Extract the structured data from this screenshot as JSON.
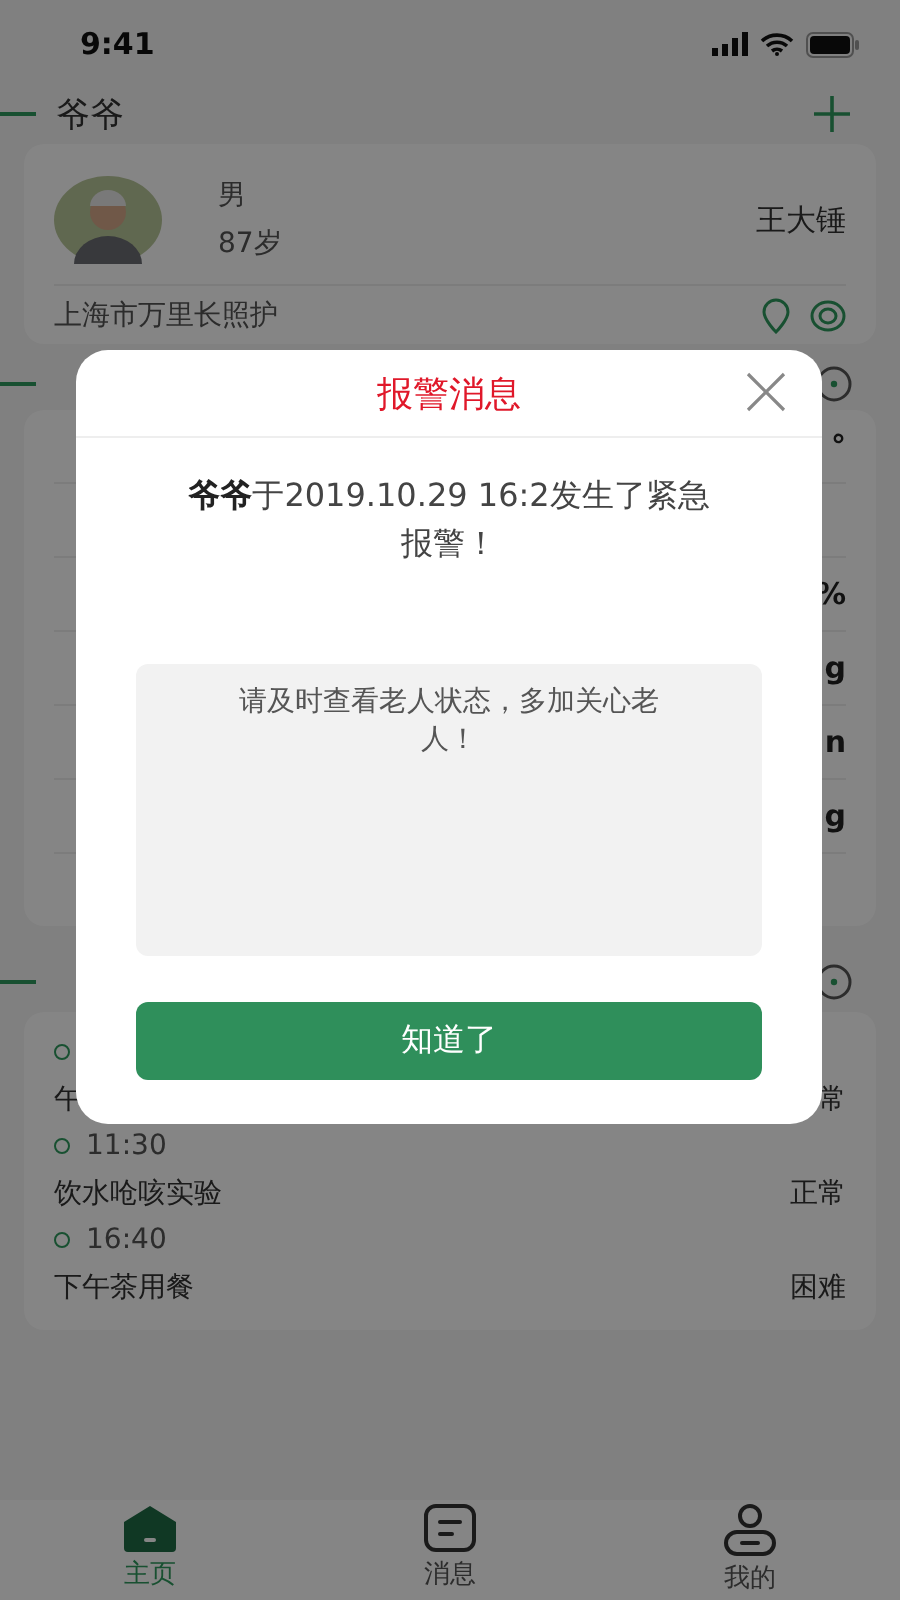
{
  "status_bar": {
    "time": "9:41"
  },
  "person": {
    "title": "爷爷",
    "gender": "男",
    "age": "87岁",
    "caregiver": "王大锤",
    "organization": "上海市万里长照护"
  },
  "basic_info": {
    "rows": [
      {
        "kind": "value",
        "value": "°"
      },
      {
        "kind": "covered"
      },
      {
        "kind": "value",
        "value": "%"
      },
      {
        "kind": "value",
        "value": "g"
      },
      {
        "kind": "value",
        "value": "n"
      },
      {
        "kind": "value",
        "value": "g"
      },
      {
        "kind": "covered"
      }
    ]
  },
  "schedule": {
    "items": [
      {
        "activity": "午",
        "status": "常"
      },
      {
        "time": "11:30",
        "activity": "饮水呛咳实验",
        "status": "正常"
      },
      {
        "time": "16:40",
        "activity": "下午茶用餐",
        "status": "困难"
      }
    ]
  },
  "tabs": [
    {
      "label": "主页",
      "selected": true
    },
    {
      "label": "消息",
      "selected": false
    },
    {
      "label": "我的",
      "selected": false
    }
  ],
  "dialog": {
    "title": "报警消息",
    "message": "**爷爷**于2019.10.29 16:2发生了紧急报警！",
    "note": "请及时查看老人状态，多加关心老人！",
    "button": "知道了"
  }
}
